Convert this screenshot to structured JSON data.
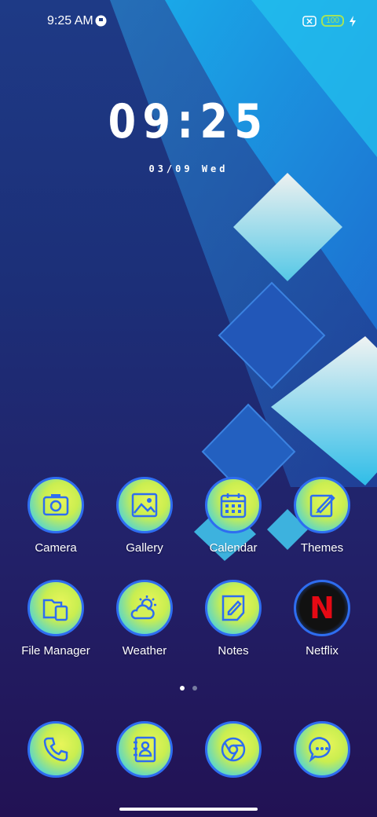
{
  "status_bar": {
    "time": "9:25 AM",
    "battery_level": "100"
  },
  "clock": {
    "time": "09:25",
    "date": "03/09 Wed"
  },
  "apps": [
    {
      "label": "Camera",
      "icon": "camera-icon"
    },
    {
      "label": "Gallery",
      "icon": "gallery-icon"
    },
    {
      "label": "Calendar",
      "icon": "calendar-icon"
    },
    {
      "label": "Themes",
      "icon": "themes-icon"
    },
    {
      "label": "File Manager",
      "icon": "file-manager-icon"
    },
    {
      "label": "Weather",
      "icon": "weather-icon"
    },
    {
      "label": "Notes",
      "icon": "notes-icon"
    },
    {
      "label": "Netflix",
      "icon": "netflix-icon",
      "logo_text": "N"
    }
  ],
  "dock": [
    {
      "icon": "phone-icon"
    },
    {
      "icon": "contacts-icon"
    },
    {
      "icon": "browser-icon"
    },
    {
      "icon": "messages-icon"
    }
  ],
  "page_indicator": {
    "pages": 2,
    "active": 1
  },
  "colors": {
    "accent_blue": "#2e6df0",
    "icon_yellow": "#e8f55a",
    "battery_green": "#a4e35a",
    "netflix_red": "#e50914"
  }
}
